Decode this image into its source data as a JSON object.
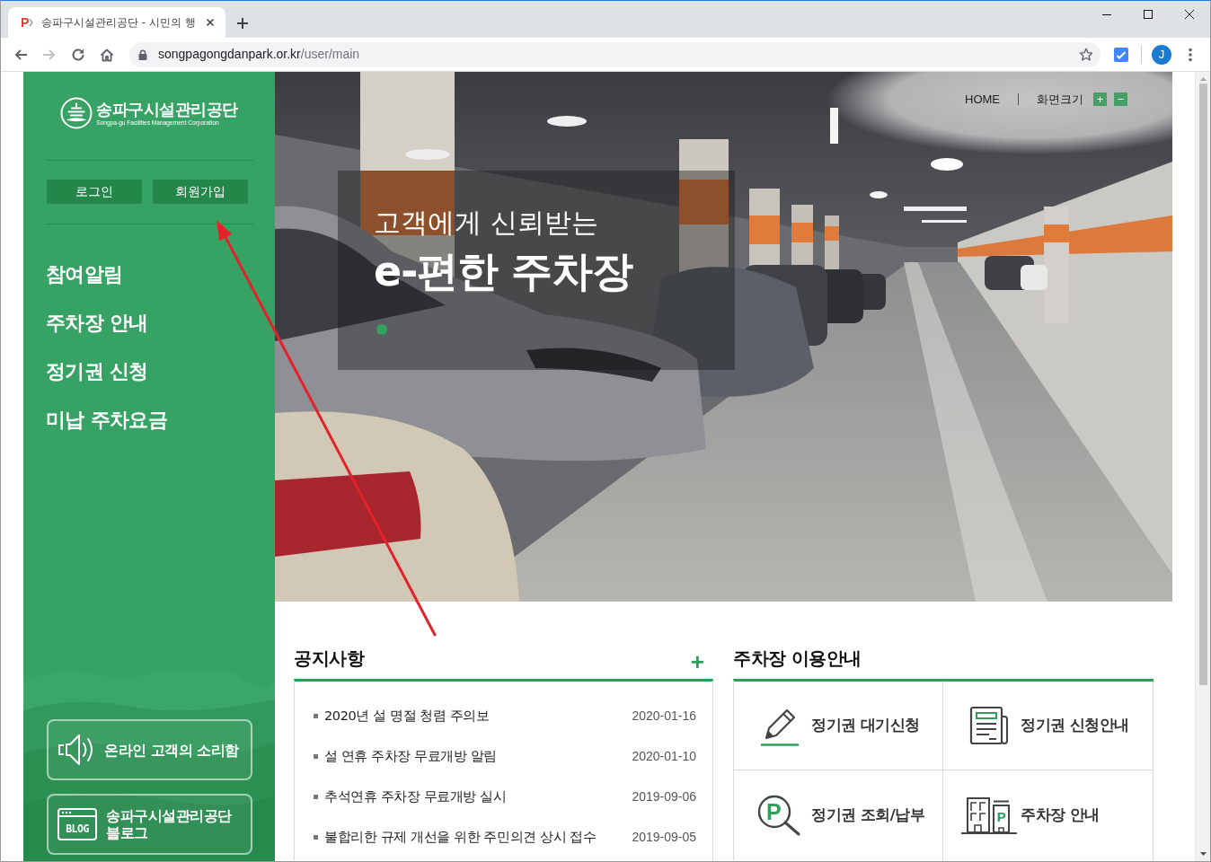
{
  "browser": {
    "tab": {
      "favicon": "P",
      "title": "송파구시설관리공단 - 시민의 행",
      "selected": true
    },
    "forward_disabled": true,
    "address": {
      "domain": "songpagongdanpark.or.kr",
      "path": "/user/main"
    },
    "profile": "J"
  },
  "sidebar": {
    "logo": {
      "name": "송파구시설관리공단",
      "subtitle": "Songpa-gu Facilities Management Corporation"
    },
    "auth_buttons": [
      "로그인",
      "회원가입"
    ],
    "menu": [
      "참여알림",
      "주차장 안내",
      "정기권 신청",
      "미납 주차요금"
    ],
    "quick_links": [
      {
        "kind": "voice",
        "label": "온라인 고객의 소리함"
      },
      {
        "kind": "blog",
        "icon_text": "BLOG",
        "label": "송파구시설관리공단\n블로그"
      }
    ]
  },
  "utility_bar": {
    "home": "HOME",
    "zoom_label": "화면크기",
    "zoom_in": "+",
    "zoom_out": "−"
  },
  "hero": {
    "subtitle": "고객에게 신뢰받는",
    "title": "e-편한 주차장",
    "slides": [
      {
        "selected": true
      }
    ]
  },
  "notices": {
    "title": "공지사항",
    "more": "+",
    "items": [
      {
        "title": "2020년 설 명절 청렴 주의보",
        "date": "2020-01-16"
      },
      {
        "title": "설 연휴 주차장 무료개방 알림",
        "date": "2020-01-10"
      },
      {
        "title": "추석연휴 주차장 무료개방 실시",
        "date": "2019-09-06"
      },
      {
        "title": "불합리한 규제 개선을 위한 주민의견 상시 접수",
        "date": "2019-09-05"
      }
    ]
  },
  "parking_guide": {
    "title": "주차장 이용안내",
    "items": [
      {
        "kind": "pencil",
        "label": "정기권 대기신청"
      },
      {
        "kind": "document",
        "label": "정기권 신청안내"
      },
      {
        "kind": "search",
        "icon_text": "P",
        "label": "정기권 조회/납부"
      },
      {
        "kind": "building",
        "icon_text": "P",
        "label": "주차장 안내"
      }
    ]
  }
}
